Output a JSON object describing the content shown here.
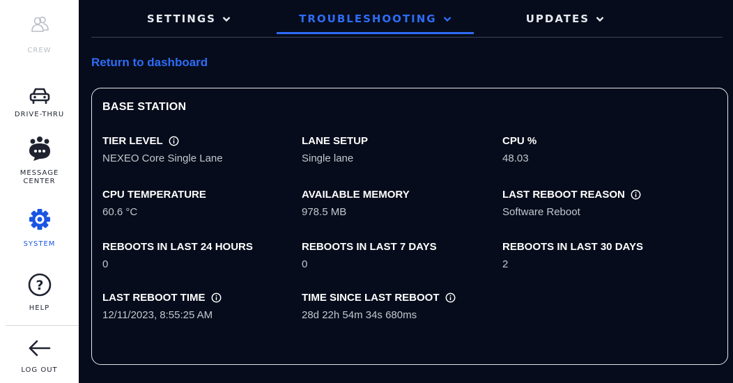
{
  "sidebar": {
    "items": [
      {
        "label": "CREW",
        "icon": "crew-icon"
      },
      {
        "label": "DRIVE-THRU",
        "icon": "car-icon"
      },
      {
        "label_line1": "MESSAGE",
        "label_line2": "CENTER",
        "icon": "message-center-icon"
      },
      {
        "label": "SYSTEM",
        "icon": "gear-icon",
        "active": true
      },
      {
        "label": "HELP",
        "icon": "help-icon"
      },
      {
        "label": "LOG OUT",
        "icon": "arrow-left-icon"
      }
    ]
  },
  "tabs": [
    {
      "label": "SETTINGS",
      "active": false
    },
    {
      "label": "TROUBLESHOOTING",
      "active": true
    },
    {
      "label": "UPDATES",
      "active": false
    }
  ],
  "return_link": "Return to dashboard",
  "card": {
    "title": "BASE STATION",
    "metrics": [
      {
        "label": "TIER LEVEL",
        "value": "NEXEO Core Single Lane",
        "info": true
      },
      {
        "label": "LANE SETUP",
        "value": "Single lane",
        "info": false
      },
      {
        "label": "CPU %",
        "value": "48.03",
        "info": false
      },
      {
        "label": "CPU TEMPERATURE",
        "value": "60.6 °C",
        "info": false
      },
      {
        "label": "AVAILABLE MEMORY",
        "value": "978.5 MB",
        "info": false
      },
      {
        "label": "LAST REBOOT REASON",
        "value": "Software Reboot",
        "info": true
      },
      {
        "label": "REBOOTS IN LAST 24 HOURS",
        "value": "0",
        "info": false
      },
      {
        "label": "REBOOTS IN LAST 7 DAYS",
        "value": "0",
        "info": false
      },
      {
        "label": "REBOOTS IN LAST 30 DAYS",
        "value": "2",
        "info": false
      },
      {
        "label": "LAST REBOOT TIME",
        "value": "12/11/2023, 8:55:25 AM",
        "info": true
      },
      {
        "label": "TIME SINCE LAST REBOOT",
        "value": "28d 22h 54m 34s 680ms",
        "info": true
      }
    ]
  },
  "colors": {
    "accent": "#2e6cf6",
    "panel_bg": "#060c1b",
    "sidebar_bg": "#ffffff"
  }
}
